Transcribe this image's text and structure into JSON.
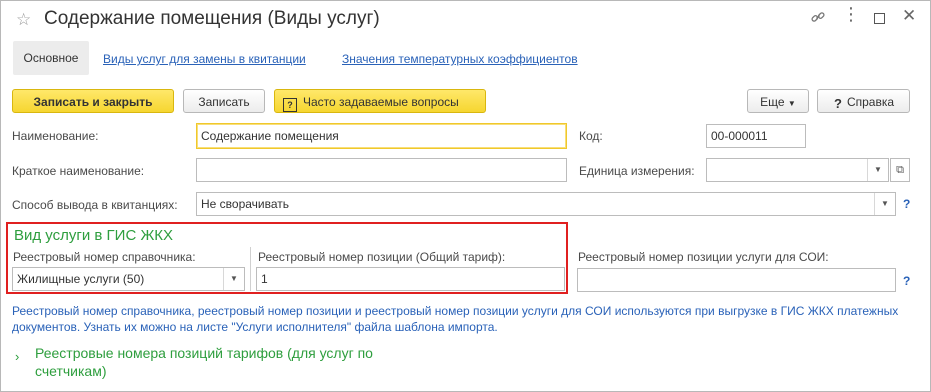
{
  "window": {
    "title": "Содержание помещения (Виды услуг)"
  },
  "tabs": [
    {
      "label": "Основное"
    },
    {
      "label": "Виды услуг для замены в квитанции"
    },
    {
      "label": "Значения температурных коэффициентов"
    }
  ],
  "toolbar": {
    "save_close": "Записать и закрыть",
    "save": "Записать",
    "faq": "Часто задаваемые вопросы",
    "more": "Еще",
    "help": "Справка"
  },
  "form": {
    "name_label": "Наименование:",
    "name_value": "Содержание помещения",
    "code_label": "Код:",
    "code_value": "00-000011",
    "short_name_label": "Краткое наименование:",
    "short_name_value": "",
    "unit_label": "Единица измерения:",
    "unit_value": "",
    "output_label": "Способ вывода в квитанциях:",
    "output_value": "Не сворачивать"
  },
  "gis": {
    "heading": "Вид услуги в ГИС ЖКХ",
    "ref_label": "Реестровый номер справочника:",
    "ref_value": "Жилищные услуги (50)",
    "pos_label": "Реестровый номер позиции (Общий тариф):",
    "pos_value": "1",
    "soi_label": "Реестровый номер позиции услуги для СОИ:",
    "soi_value": ""
  },
  "info_text": "Реестровый номер справочника, реестровый номер позиции и реестровый номер позиции услуги для СОИ используются при выгрузке в ГИС ЖКХ платежных документов. Узнать их можно на листе \"Услуги исполнителя\" файла шаблона импорта.",
  "tariff_section": {
    "line1": "Реестровые номера позиций тарифов (для услуг по",
    "line2": "счетчикам)"
  }
}
